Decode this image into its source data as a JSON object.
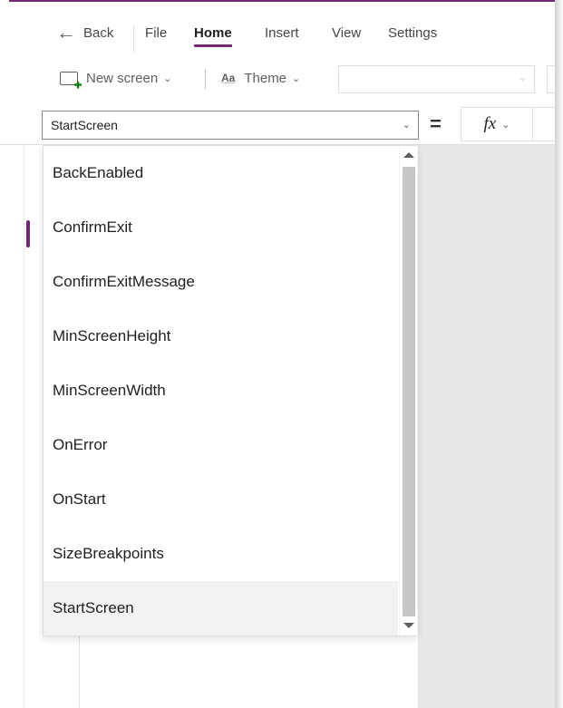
{
  "menubar": {
    "back_label": "Back",
    "items": [
      "File",
      "Home",
      "Insert",
      "View",
      "Settings"
    ],
    "active": "Home"
  },
  "toolbar": {
    "new_screen_label": "New screen",
    "theme_icon_text": "Aa",
    "theme_label": "Theme"
  },
  "formula_bar": {
    "selected_property": "StartScreen",
    "equals": "=",
    "fx_label": "fx"
  },
  "property_dropdown": {
    "options": [
      "BackEnabled",
      "ConfirmExit",
      "ConfirmExitMessage",
      "MinScreenHeight",
      "MinScreenWidth",
      "OnError",
      "OnStart",
      "SizeBreakpoints",
      "StartScreen"
    ],
    "selected": "StartScreen"
  },
  "colors": {
    "accent": "#742774",
    "canvas": "#e6e6e6",
    "selected_option": "#f3f2f1"
  }
}
